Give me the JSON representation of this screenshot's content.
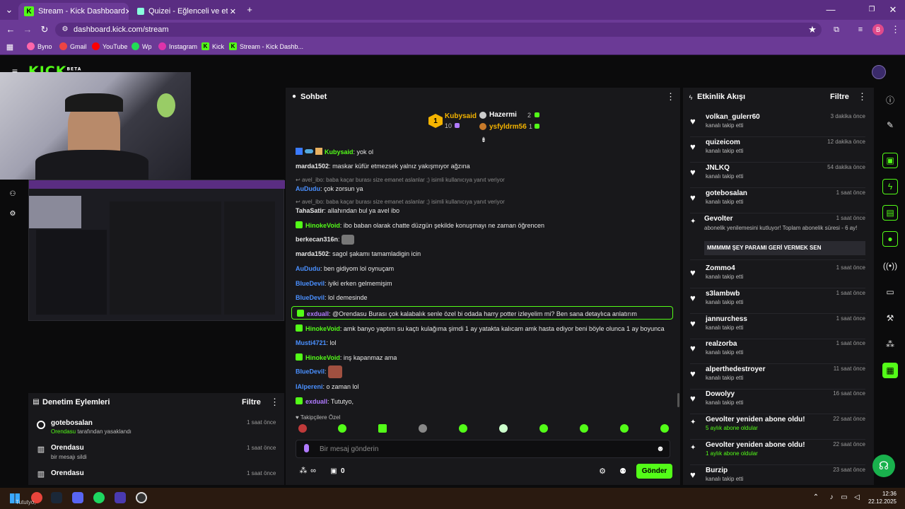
{
  "browser": {
    "tabs": [
      {
        "label": "Stream - Kick Dashboard"
      },
      {
        "label": "Quizei - Eğlenceli ve etkileşimli"
      }
    ],
    "url": "dashboard.kick.com/stream",
    "bookmarks": [
      "Byno",
      "Gmail",
      "YouTube",
      "Wp",
      "Instagram",
      "Kick",
      "Stream - Kick Dashb..."
    ],
    "profile_initial": "B"
  },
  "kick": {
    "logo": "KICK",
    "logo_badge": "BETA"
  },
  "chat": {
    "title": "Sohbet",
    "leaderboard": [
      {
        "rank": "1",
        "name": "Kubysaid",
        "count": "10"
      },
      {
        "name": "Hazermi",
        "count": "2"
      },
      {
        "name": "ysfyldrm56",
        "count": "1"
      }
    ],
    "messages": [
      {
        "user": "Kubysaid",
        "text": "yok ol",
        "color": "#53fc18"
      },
      {
        "user": "marda1502",
        "text": "maskar küfür etmezsek yalnız yakışmıyor ağzına",
        "color": "#e8e8e8"
      },
      {
        "reply": "avel_ibo: baba kaçar burası size emanet aslanlar ;) isimli kullanıcıya yanıt veriyor"
      },
      {
        "user": "AuDudu",
        "text": "çok zorsun ya",
        "color": "#4a90ff"
      },
      {
        "reply": "avel_ibo: baba kaçar burası size emanet aslanlar ;) isimli kullanıcıya yanıt veriyor"
      },
      {
        "user": "TahaSatir",
        "text": "allahından bul ya avel ibo",
        "color": "#e8e8e8"
      },
      {
        "user": "HinokeVoid",
        "text": "ibo baban olarak chatte düzgün şekilde konuşmayı ne zaman öğrencen",
        "color": "#53fc18"
      },
      {
        "user": "berkecan316n",
        "text": "",
        "color": "#e8e8e8"
      },
      {
        "user": "marda1502",
        "text": "sagol şakamı tamamladigin icin",
        "color": "#e8e8e8"
      },
      {
        "user": "AuDudu",
        "text": "ben gidiyom lol oynuçam",
        "color": "#4a90ff"
      },
      {
        "user": "BlueDevil",
        "text": "iyiki erken gelmemişim",
        "color": "#4a90ff"
      },
      {
        "user": "BlueDevil",
        "text": "lol demesinde",
        "color": "#4a90ff"
      },
      {
        "user": "exduall",
        "text": "@Orendasu Burası çok kalabalık senle özel bi odada harry potter izleyelim mi? Ben sana detaylıca anlatırım",
        "color": "#b07aff"
      },
      {
        "user": "HinokeVoid",
        "text": "amk banyo yaptım su kaçtı kulağıma şimdi 1 ay yatakta kalıcam amk hasta ediyor beni böyle olunca 1 ay boyunca",
        "color": "#53fc18"
      },
      {
        "user": "Musti4721",
        "text": "lol",
        "color": "#4a90ff"
      },
      {
        "user": "HinokeVoid",
        "text": "inş kapanmaz ama",
        "color": "#53fc18"
      },
      {
        "user": "BlueDevil",
        "text": "",
        "color": "#4a90ff"
      },
      {
        "user": "IAlpereni",
        "text": "o zaman lol",
        "color": "#4a90ff"
      },
      {
        "user": "exduall",
        "text": "Tututyo,",
        "color": "#b07aff"
      }
    ],
    "followers_only": "Takipçilere Özel",
    "input_placeholder": "Bir mesaj gönderin",
    "points": "0",
    "send_label": "Gönder"
  },
  "activity": {
    "title": "Etkinlik Akışı",
    "filter": "Filtre",
    "items": [
      {
        "name": "volkan_gulerr60",
        "sub": "kanalı takip etti",
        "time": "3 dakika önce"
      },
      {
        "name": "quizeicom",
        "sub": "kanalı takip etti",
        "time": "12 dakika önce"
      },
      {
        "name": "JNLKQ",
        "sub": "kanalı takip etti",
        "time": "54 dakika önce"
      },
      {
        "name": "gotebosalan",
        "sub": "kanalı takip etti",
        "time": "1 saat önce"
      },
      {
        "name": "Gevolter",
        "sub": "abonelik yenilemesini kutluyor! Toplam abonelik süresi - 6 ay!",
        "time": "1 saat önce",
        "note": "MMMMM ŞEY PARAMI GERİ VERMEK SEN"
      },
      {
        "name": "Zommo4",
        "sub": "kanalı takip etti",
        "time": "1 saat önce"
      },
      {
        "name": "s3lambwb",
        "sub": "kanalı takip etti",
        "time": "1 saat önce"
      },
      {
        "name": "jannurchess",
        "sub": "kanalı takip etti",
        "time": "1 saat önce"
      },
      {
        "name": "realzorba",
        "sub": "kanalı takip etti",
        "time": "1 saat önce"
      },
      {
        "name": "alperthedestroyer",
        "sub": "kanalı takip etti",
        "time": "11 saat önce"
      },
      {
        "name": "Dowolyy",
        "sub": "kanalı takip etti",
        "time": "16 saat önce"
      },
      {
        "name": "Gevolter yeniden abone oldu!",
        "sub": "5 aylık abone oldular",
        "time": "22 saat önce"
      },
      {
        "name": "Gevolter yeniden abone oldu!",
        "sub": "1 aylık abone oldular",
        "time": "22 saat önce"
      },
      {
        "name": "Burzip",
        "sub": "kanalı takip etti",
        "time": "23 saat önce"
      }
    ]
  },
  "moderation": {
    "title": "Denetim Eylemleri",
    "filter": "Filtre",
    "items": [
      {
        "name": "gotebosalan",
        "sub_user": "Orendasu",
        "sub": "tarafından yasaklandı",
        "time": "1 saat önce"
      },
      {
        "name": "Orendasu",
        "sub": "bir mesajı sildi",
        "time": "1 saat önce"
      },
      {
        "name": "Orendasu",
        "sub": "",
        "time": "1 saat önce"
      }
    ]
  },
  "taskbar": {
    "time": "12:36",
    "date": "22.12.2025",
    "overlay_text": "Tututyo,"
  }
}
